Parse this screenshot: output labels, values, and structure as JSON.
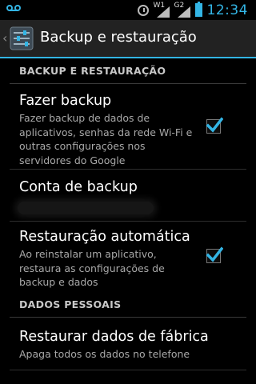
{
  "status_bar": {
    "time": "12:34",
    "signal1_label": "W1",
    "signal2_label": "G2",
    "icons": [
      "voicemail-icon",
      "alarm-icon",
      "signal-icon",
      "signal-icon",
      "battery-icon"
    ],
    "accent_color": "#33b5e5"
  },
  "action_bar": {
    "title": "Backup e restauração",
    "icon": "settings-icon"
  },
  "sections": {
    "backup_header": "BACKUP E RESTAURAÇÃO",
    "personal_header": "DADOS PESSOAIS"
  },
  "prefs": {
    "backup": {
      "title": "Fazer backup",
      "summary": "Fazer backup de dados de aplicativos, senhas da rede Wi-Fi e outras configurações nos servidores do Google",
      "checked": true
    },
    "account": {
      "title": "Conta de backup"
    },
    "auto_restore": {
      "title": "Restauração automática",
      "summary": "Ao reinstalar um aplicativo, restaura as configurações de backup e dados",
      "checked": true
    },
    "factory_reset": {
      "title": "Restaurar dados de fábrica",
      "summary": "Apaga todos os dados no telefone"
    }
  }
}
